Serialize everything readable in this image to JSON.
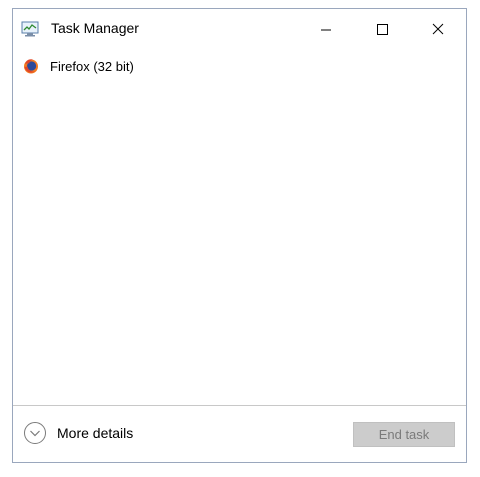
{
  "window": {
    "title": "Task Manager",
    "app_icon": "task-manager-icon",
    "controls": {
      "minimize_icon": "minimize-icon",
      "maximize_icon": "maximize-icon",
      "close_icon": "close-icon"
    }
  },
  "apps": [
    {
      "label": "Firefox (32 bit)",
      "icon": "firefox-icon"
    }
  ],
  "footer": {
    "more_details_label": "More details",
    "more_details_icon": "chevron-down-icon",
    "end_task_label": "End task",
    "end_task_enabled": false
  },
  "colors": {
    "border": "#9aa7bd",
    "button_disabled_bg": "#cccccc",
    "button_disabled_text": "#7a7a7a"
  }
}
